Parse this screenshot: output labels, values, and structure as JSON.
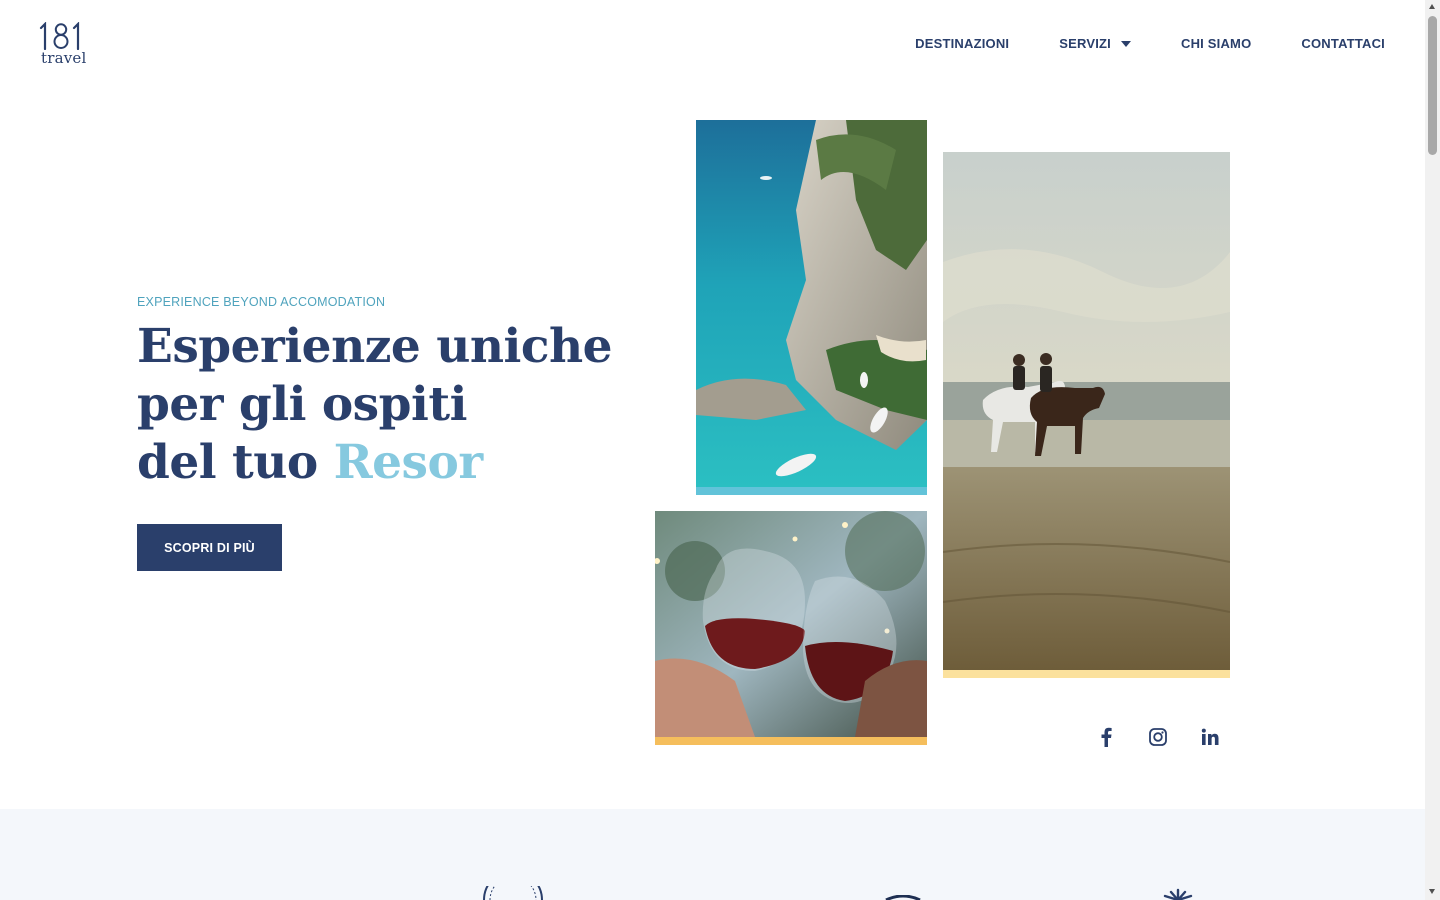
{
  "header": {
    "logo_number": "181",
    "logo_text": "travel",
    "nav": [
      {
        "label": "DESTINAZIONI"
      },
      {
        "label": "SERVIZI"
      },
      {
        "label": "CHI SIAMO"
      },
      {
        "label": "CONTATTACI"
      }
    ]
  },
  "hero": {
    "eyebrow": "EXPERIENCE BEYOND ACCOMODATION",
    "title_line1": "Esperienze uniche",
    "title_line2": "per gli ospiti",
    "title_line3_prefix": "del tuo ",
    "title_typed_word": "Resor",
    "cta_label": "SCOPRI DI PIÙ"
  },
  "gallery": [
    {
      "subject": "aerial view of rocky coast with boats on turquoise sea",
      "accent_color": "#62c3d9"
    },
    {
      "subject": "couple riding horses on a beach",
      "accent_color": "#fbe19d"
    },
    {
      "subject": "two glasses of red wine clinking",
      "accent_color": "#f5be5c"
    }
  ],
  "social": [
    {
      "icon": "facebook-icon"
    },
    {
      "icon": "instagram-icon"
    },
    {
      "icon": "linkedin-icon"
    }
  ],
  "colors": {
    "brand_navy": "#2a3f6b",
    "eyebrow_teal": "#4fa3bd",
    "typed_text": "#86c9df",
    "section_bg": "#f4f7fb"
  }
}
